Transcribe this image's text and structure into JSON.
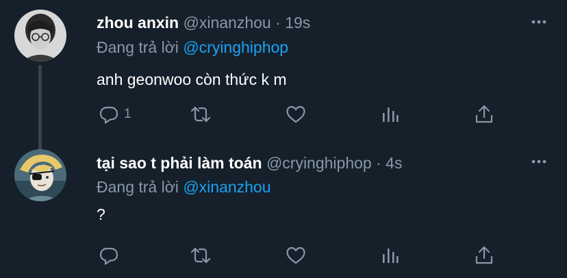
{
  "colors": {
    "background": "#15202b",
    "text_primary": "#ffffff",
    "text_secondary": "#8899a6",
    "accent": "#1da1f2",
    "thread_line": "#38444d"
  },
  "reply_prefix": "Đang trả lời",
  "tweets": [
    {
      "display_name": "zhou anxin",
      "handle": "@xinanzhou",
      "separator": "·",
      "time": "19s",
      "reply_to": "@cryinghiphop",
      "text": "anh geonwoo còn thức k m",
      "reply_count": "1",
      "icons": [
        "reply-icon",
        "retweet-icon",
        "like-icon",
        "stats-icon",
        "share-icon",
        "more-icon"
      ]
    },
    {
      "display_name": "tại sao t phải làm toán",
      "handle": "@cryinghiphop",
      "separator": "·",
      "time": "4s",
      "reply_to": "@xinanzhou",
      "text": "?",
      "reply_count": "",
      "icons": [
        "reply-icon",
        "retweet-icon",
        "like-icon",
        "stats-icon",
        "share-icon",
        "more-icon"
      ]
    }
  ]
}
